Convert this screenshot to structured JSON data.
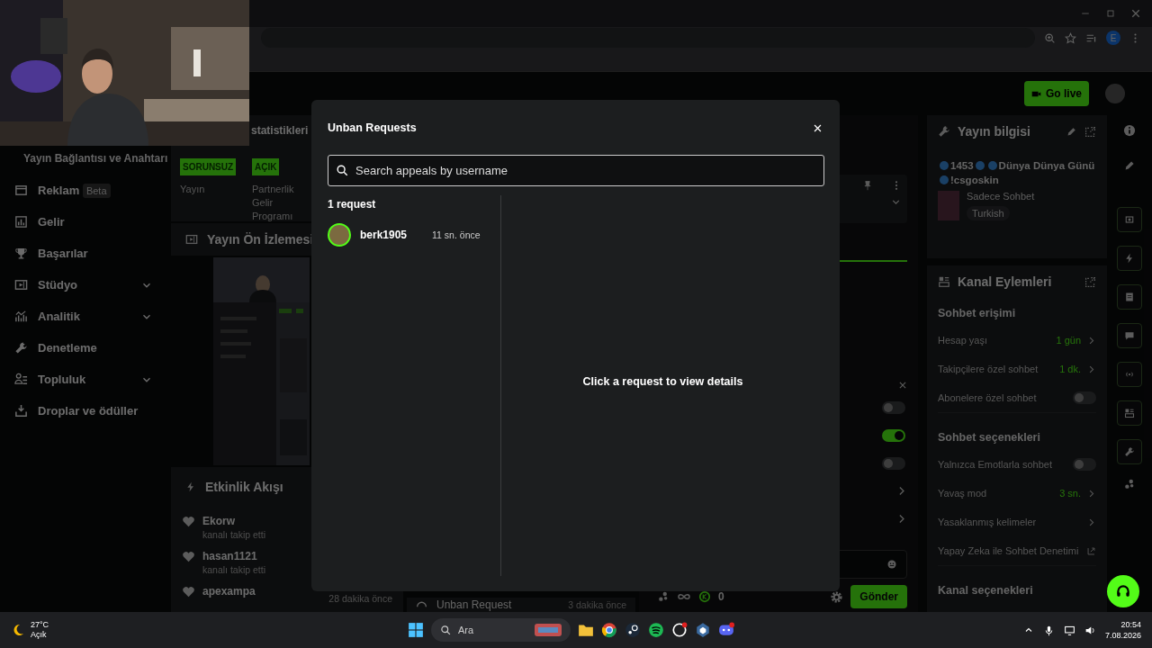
{
  "browser": {
    "profile_initial": "E"
  },
  "header": {
    "go_live": "Go live"
  },
  "sidebar": {
    "section_title": "Yayın Bağlantısı ve Anahtarı",
    "items": [
      {
        "label": "Reklam",
        "badge": "Beta",
        "expandable": false
      },
      {
        "label": "Gelir",
        "expandable": false
      },
      {
        "label": "Başarılar",
        "expandable": false
      },
      {
        "label": "Stüdyo",
        "expandable": true
      },
      {
        "label": "Analitik",
        "expandable": true
      },
      {
        "label": "Denetleme",
        "expandable": false
      },
      {
        "label": "Topluluk",
        "expandable": true
      },
      {
        "label": "Droplar ve ödüller",
        "expandable": false
      }
    ]
  },
  "stats": {
    "title_fragment": "statistikleri",
    "badges": [
      "SORUNSUZ",
      "AÇIK"
    ],
    "captions": [
      "Yayın",
      "Partnerlik Gelir Programı"
    ]
  },
  "preview": {
    "title": "Yayın Ön İzlemesi"
  },
  "activity": {
    "title": "Etkinlik Akışı",
    "events": [
      {
        "user": "Ekorw",
        "action": "kanalı takip etti"
      },
      {
        "user": "hasan1121",
        "action": "kanalı takip etti"
      },
      {
        "user": "apexampa",
        "time": "28 dakika önce"
      }
    ]
  },
  "requests_panel": {
    "items": [
      {
        "title": "Unban Request",
        "time": "3 dakika önce"
      }
    ]
  },
  "chat": {
    "toggles": [
      {
        "on": false
      },
      {
        "on": true
      },
      {
        "on": false
      }
    ],
    "gift_count": "0",
    "send": "Gönder"
  },
  "stream_info": {
    "title": "Yayın bilgisi",
    "title_parts": [
      "1453",
      "Dünya Dünya Günü",
      "!csgoskin"
    ],
    "category": "Sadece Sohbet",
    "language": "Turkish"
  },
  "channel_actions": {
    "title": "Kanal Eylemleri",
    "sections": [
      {
        "heading": "Sohbet erişimi",
        "rows": [
          {
            "kind": "value",
            "label": "Hesap yaşı",
            "value": "1 gün"
          },
          {
            "kind": "value",
            "label": "Takipçilere özel sohbet",
            "value": "1 dk."
          },
          {
            "kind": "toggle",
            "label": "Abonelere özel sohbet",
            "on": false
          }
        ]
      },
      {
        "heading": "Sohbet seçenekleri",
        "rows": [
          {
            "kind": "toggle",
            "label": "Yalnızca Emotlarla sohbet",
            "on": false
          },
          {
            "kind": "value",
            "label": "Yavaş mod",
            "value": "3 sn."
          },
          {
            "kind": "link",
            "label": "Yasaklanmış kelimeler"
          },
          {
            "kind": "external",
            "label": "Yapay Zeka ile Sohbet Denetimi"
          }
        ]
      },
      {
        "heading": "Kanal seçenekleri"
      }
    ]
  },
  "modal": {
    "title": "Unban Requests",
    "search_placeholder": "Search appeals by username",
    "count": "1 request",
    "requests": [
      {
        "user": "berk1905",
        "time": "11 sn. önce"
      }
    ],
    "empty_detail": "Click a request to view details"
  },
  "taskbar": {
    "temperature": "27°C",
    "weather": "Açık",
    "search": "Ara",
    "time": "20:54",
    "date": "7.08.2026"
  }
}
